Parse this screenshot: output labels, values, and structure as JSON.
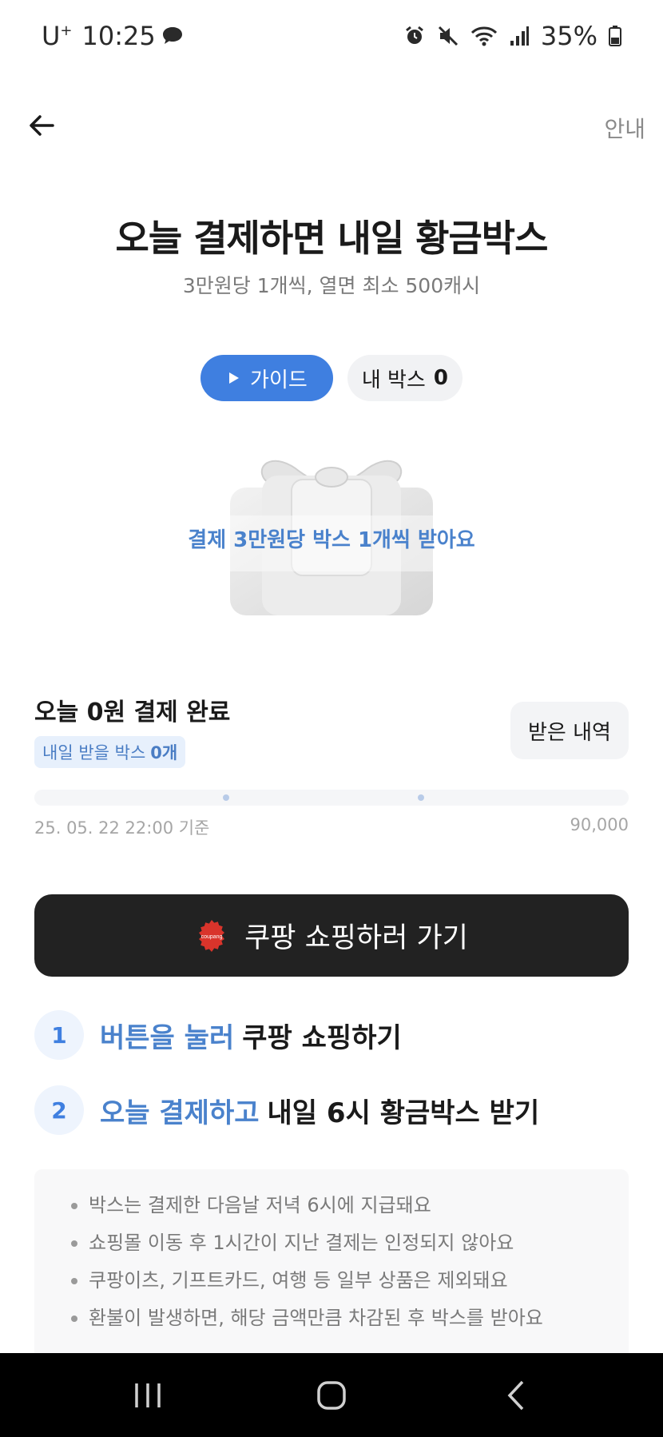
{
  "status_bar": {
    "carrier": "U",
    "carrier_sup": "+",
    "time": "10:25",
    "battery": "35%"
  },
  "header": {
    "guide_link": "안내"
  },
  "hero": {
    "title": "오늘 결제하면 내일 황금박스",
    "subtitle": "3만원당 1개씩, 열면 최소 500캐시",
    "guide_button": "가이드",
    "my_box_label": "내 박스",
    "my_box_count": "0",
    "gift_caption": "결제 3만원당 박스 1개씩 받아요"
  },
  "summary": {
    "today_status": "오늘 0원 결제 완료",
    "tomorrow_label": "내일 받을 박스",
    "tomorrow_count": "0개",
    "history_button": "받은 내역",
    "progress_fraction": 0.0,
    "timestamp": "25. 05. 22 22:00 기준",
    "max_amount": "90,000"
  },
  "cta": {
    "logo_text": "coupang",
    "label": "쿠팡 쇼핑하러 가기"
  },
  "steps": [
    {
      "number": "1",
      "highlight": "버튼을 눌러",
      "text": "쿠팡 쇼핑하기"
    },
    {
      "number": "2",
      "highlight": "오늘 결제하고",
      "text": "내일 6시 황금박스 받기"
    }
  ],
  "notices": [
    "박스는 결제한 다음날 저녁 6시에 지급돼요",
    "쇼핑몰 이동 후 1시간이 지난 결제는 인정되지 않아요",
    "쿠팡이츠, 기프트카드, 여행 등 일부 상품은 제외돼요",
    "환불이 발생하면, 해당 금액만큼 차감된 후 박스를 받아요"
  ],
  "colors": {
    "accent": "#3f7fe0",
    "highlight_text": "#4a82cc",
    "cta_background": "#222222",
    "coupang_red": "#d9342b"
  }
}
